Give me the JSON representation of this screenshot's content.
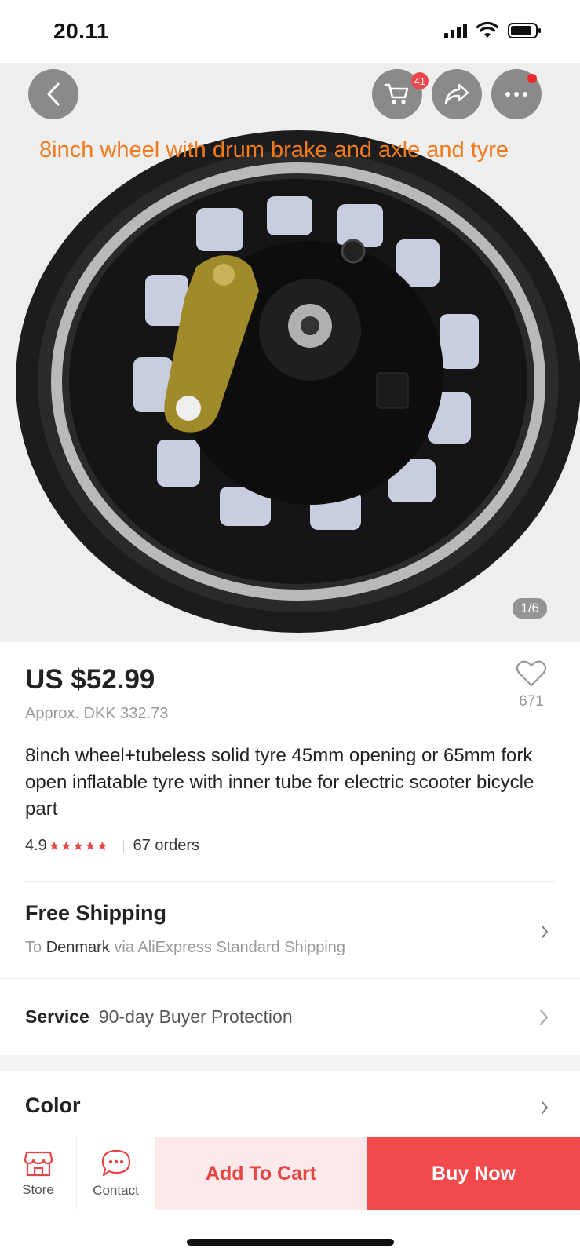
{
  "status_bar": {
    "time": "20.11"
  },
  "hero": {
    "caption": "8inch wheel with drum brake and axle  and tyre",
    "cart_badge": "41",
    "page_indicator": "1/6"
  },
  "product": {
    "price": "US $52.99",
    "approx_price": "Approx. DKK 332.73",
    "wishlist_count": "671",
    "title": "8inch wheel+tubeless solid tyre 45mm opening or 65mm fork open inflatable tyre with inner tube for electric scooter bicycle part",
    "rating": "4.9",
    "stars": "★★★★★",
    "orders": "67 orders"
  },
  "shipping": {
    "title": "Free Shipping",
    "to_label": "To",
    "destination": "Denmark",
    "via_text": "via AliExpress Standard Shipping"
  },
  "service": {
    "label": "Service",
    "value": "90-day Buyer Protection"
  },
  "color": {
    "label": "Color"
  },
  "action_bar": {
    "store_label": "Store",
    "contact_label": "Contact",
    "add_to_cart_label": "Add To Cart",
    "buy_now_label": "Buy Now"
  },
  "colors": {
    "accent_red": "#f24a4c",
    "cart_bg": "#fde9e9",
    "caption_orange": "#f07a1e"
  },
  "icons": [
    "back-icon",
    "cart-icon",
    "share-icon",
    "more-icon",
    "heart-icon",
    "store-icon",
    "chat-icon",
    "chevron-right-icon",
    "signal-icon",
    "wifi-icon",
    "battery-icon"
  ]
}
